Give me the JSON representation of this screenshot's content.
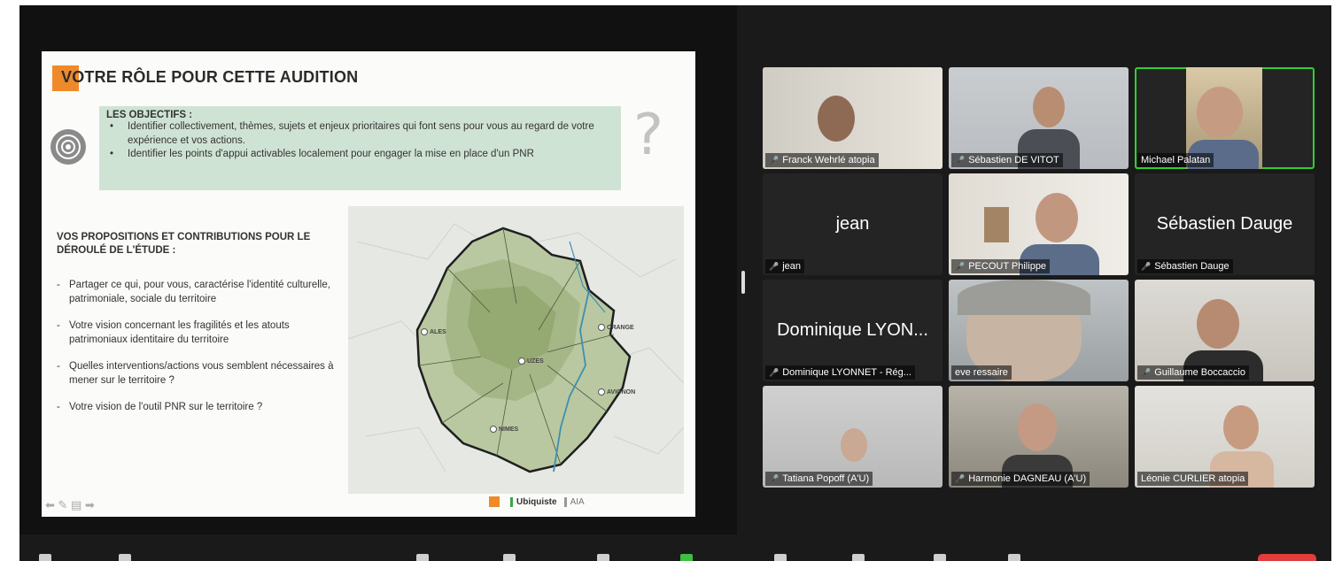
{
  "slide": {
    "title": "VOTRE RÔLE POUR CETTE AUDITION",
    "objectives_title": "LES OBJECTIFS :",
    "objectives": [
      "Identifier collectivement, thèmes, sujets et enjeux prioritaires qui font sens pour vous au regard de votre expérience et vos actions.",
      "Identifier les points d'appui activables localement pour engager la mise en place d'un PNR"
    ],
    "question_mark": "?",
    "proposals_title": "VOS PROPOSITIONS ET CONTRIBUTIONS POUR LE DÉROULÉ DE L'ÉTUDE :",
    "proposals": [
      "Partager ce qui, pour vous, caractérise l'identité culturelle, patrimoniale, sociale du territoire",
      "Votre vision concernant les fragilités et les atouts patrimoniaux identitaire du territoire",
      "Quelles interventions/actions vous semblent nécessaires à mener sur le territoire ?",
      "Votre vision de l'outil PNR sur le territoire ?"
    ],
    "map_cities": [
      "ALES",
      "ORANGE",
      "UZES",
      "AVIGNON",
      "NIMES"
    ],
    "tools_glyphs": "⬅ ✎ ▤ ➡",
    "logo_text": "Ubiquiste",
    "logo2_text": "AIA"
  },
  "participants": [
    {
      "name": "Franck Wehrlé atopia",
      "video": true,
      "muted": true
    },
    {
      "name": "Sébastien DE VITOT",
      "video": true,
      "muted": true
    },
    {
      "name": "Michael Palatan",
      "video": true,
      "muted": false,
      "active": true
    },
    {
      "name": "jean",
      "display_name": "jean",
      "video": false,
      "muted": true
    },
    {
      "name": "PECOUT Philippe",
      "video": true,
      "muted": true
    },
    {
      "name": "Sébastien Dauge",
      "display_name": "Sébastien Dauge",
      "video": false,
      "muted": true
    },
    {
      "name": "Dominique LYONNET - Rég...",
      "display_name": "Dominique LYON...",
      "video": false,
      "muted": true
    },
    {
      "name": "eve ressaire",
      "video": true,
      "muted": false
    },
    {
      "name": "Guillaume Boccaccio",
      "video": true,
      "muted": true
    },
    {
      "name": "Tatiana Popoff (A'U)",
      "video": true,
      "muted": true
    },
    {
      "name": "Harmonie DAGNEAU (A'U)",
      "video": true,
      "muted": true
    },
    {
      "name": "Léonie CURLIER atopia",
      "video": true,
      "muted": false
    }
  ],
  "colors": {
    "accent_orange": "#ef8a2a",
    "objectives_bg": "#cfe3d4",
    "active_speaker": "#2fd02f",
    "muted_red": "#e03232"
  }
}
